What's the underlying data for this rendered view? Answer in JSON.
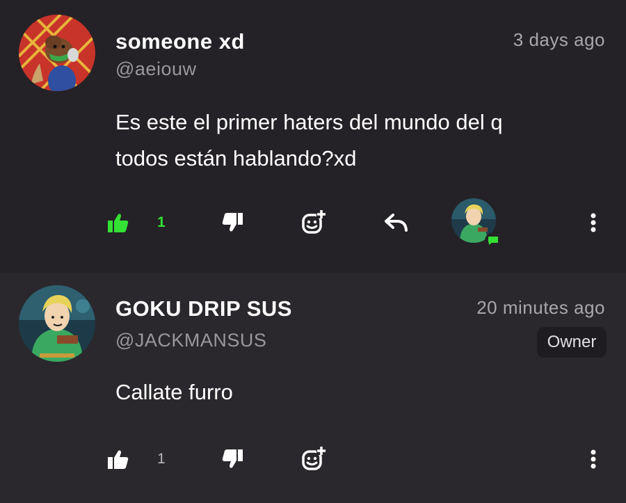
{
  "comments": [
    {
      "author": "someone xd",
      "handle": "@aeiouw",
      "time": "3 days ago",
      "text_lines": [
        "Es este el primer haters del mundo del q",
        "todos están hablando?xd"
      ],
      "likes": "1",
      "liked": true,
      "avatar_icon": "furry-character-avatar",
      "actions": [
        "like-icon",
        "dislike-icon",
        "add-reaction-icon",
        "reply-icon",
        "replier-avatar",
        "more-options-icon"
      ]
    },
    {
      "author": "GOKU DRIP SUS",
      "handle": "@JACKMANSUS",
      "time": "20 minutes ago",
      "badge": "Owner",
      "text_lines": [
        "Callate furro"
      ],
      "likes": "1",
      "liked": false,
      "avatar_icon": "link-character-avatar",
      "actions": [
        "like-icon",
        "dislike-icon",
        "add-reaction-icon",
        "more-options-icon"
      ]
    }
  ],
  "colors": {
    "like_active": "#34e034",
    "background_top": "#242226",
    "background_bottom": "#2a282c",
    "text_secondary": "#9a989c"
  }
}
